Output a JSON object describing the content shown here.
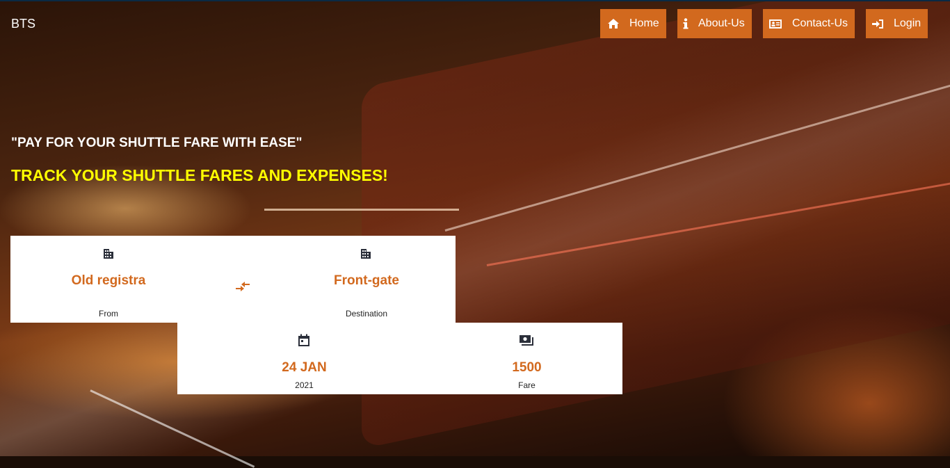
{
  "app": {
    "brand": "BTS"
  },
  "nav": [
    {
      "label": "Home",
      "icon": "home-icon"
    },
    {
      "label": "About-Us",
      "icon": "info-icon"
    },
    {
      "label": "Contact-Us",
      "icon": "contact-card-icon"
    },
    {
      "label": "Login",
      "icon": "sign-in-icon"
    }
  ],
  "hero": {
    "tagline": "\"PAY FOR YOUR SHUTTLE FARE WITH EASE\"",
    "headline": "TRACK YOUR SHUTTLE FARES AND EXPENSES!"
  },
  "route": {
    "from": {
      "value": "Old registra",
      "label": "From",
      "icon": "building-icon"
    },
    "swap_icon": "swap-arrows-icon",
    "destination": {
      "value": "Front-gate",
      "label": "Destination",
      "icon": "building-icon"
    }
  },
  "trip": {
    "date": {
      "value": "24 JAN",
      "label": "2021",
      "icon": "calendar-icon"
    },
    "fare": {
      "value": "1500",
      "label": "Fare",
      "icon": "money-icon"
    }
  },
  "colors": {
    "accent": "#d2691e",
    "headline": "#ffff00",
    "card": "#ffffff"
  }
}
